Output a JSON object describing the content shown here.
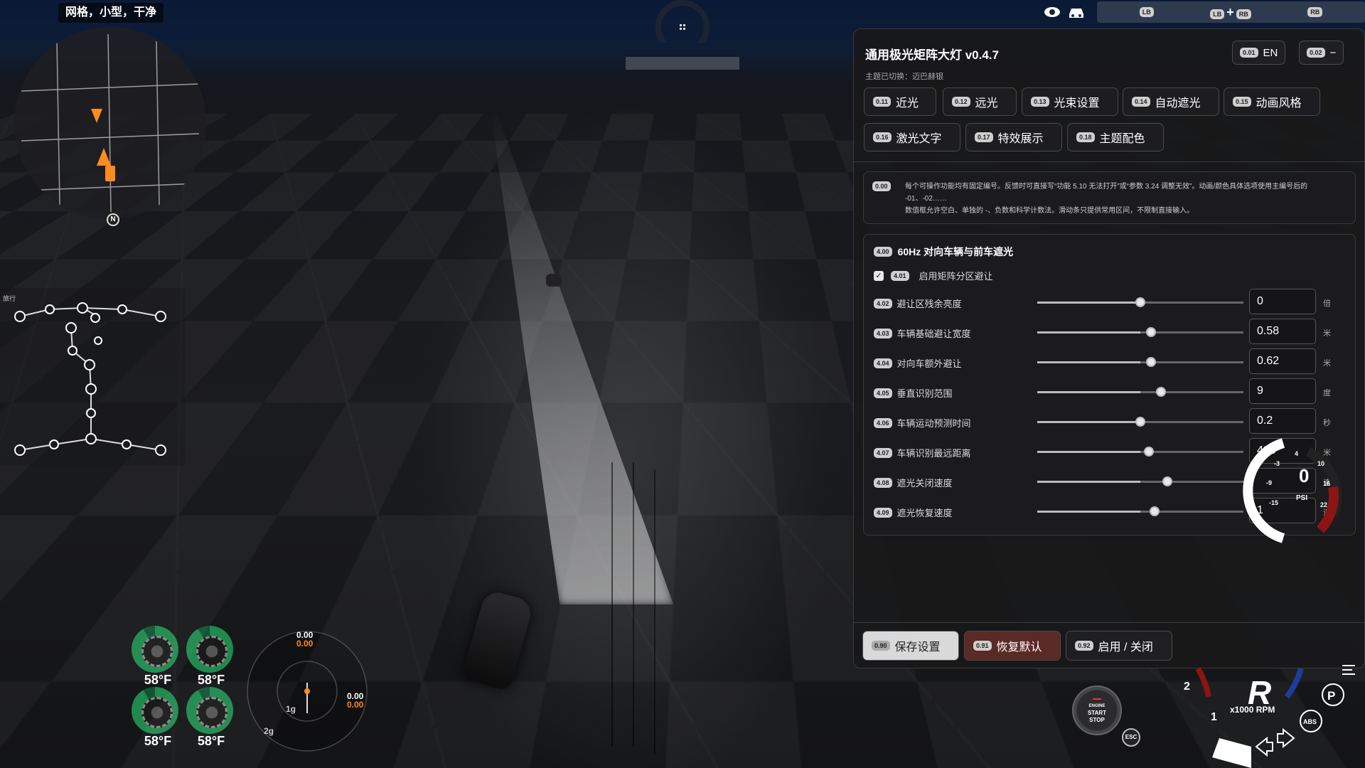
{
  "hud": {
    "map_mode": "网格，小型，干净",
    "north": "N",
    "top_buttons": {
      "btn_lb": "LB",
      "combo_lb": "LB",
      "combo_plus": "+",
      "combo_rb": "RB",
      "btn_rb": "RB"
    },
    "controller_label": "旅行"
  },
  "tires": {
    "fl": "58°F",
    "fr": "58°F",
    "rl": "58°F",
    "rr": "58°F"
  },
  "gmeter": {
    "top_white": "0.00",
    "top_orange": "0.00",
    "right_white": "0.00",
    "right_orange": "0.00",
    "ring1": "1g",
    "ring2": "2g"
  },
  "panel": {
    "title": "通用极光矩阵大灯 v0.4.7",
    "subtitle": "主题已切换：迈巴赫银",
    "lang": {
      "code": "0.01",
      "label": "EN"
    },
    "minimize": {
      "code": "0.02",
      "label": "−"
    },
    "tabs": [
      {
        "code": "0.11",
        "label": "近光"
      },
      {
        "code": "0.12",
        "label": "远光"
      },
      {
        "code": "0.13",
        "label": "光束设置"
      },
      {
        "code": "0.14",
        "label": "自动遮光"
      },
      {
        "code": "0.15",
        "label": "动画风格"
      },
      {
        "code": "0.16",
        "label": "激光文字"
      },
      {
        "code": "0.17",
        "label": "特效展示"
      },
      {
        "code": "0.18",
        "label": "主题配色"
      }
    ],
    "note": {
      "code": "0.00",
      "line1": "每个可操作功能均有固定编号。反馈时可直接写“功能 5.10 无法打开”或“参数 3.24 调整无效”。动画/颜色具体选项使用主编号后的 -01、-02……",
      "line2": "数值框允许空白、单独的 -、负数和科学计数法。滑动条只提供常用区间，不限制直接输入。"
    },
    "section": {
      "code": "4.00",
      "title": "60Hz 对向车辆与前车遮光",
      "checkbox": {
        "code": "4.01",
        "label": "启用矩阵分区避让",
        "checked": true
      },
      "rows": [
        {
          "code": "4.02",
          "label": "避让区残余亮度",
          "value": "0",
          "unit": "倍",
          "fraction": 0.5
        },
        {
          "code": "4.03",
          "label": "车辆基础避让宽度",
          "value": "0.58",
          "unit": "米",
          "fraction": 0.55
        },
        {
          "code": "4.04",
          "label": "对向车额外避让",
          "value": "0.62",
          "unit": "米",
          "fraction": 0.55
        },
        {
          "code": "4.05",
          "label": "垂直识别范围",
          "value": "9",
          "unit": "度",
          "fraction": 0.6
        },
        {
          "code": "4.06",
          "label": "车辆运动预测时间",
          "value": "0.2",
          "unit": "秒",
          "fraction": 0.5
        },
        {
          "code": "4.07",
          "label": "车辆识别最远距离",
          "value": "420",
          "unit": "米",
          "fraction": 0.54
        },
        {
          "code": "4.08",
          "label": "遮光关闭速度",
          "value": "",
          "unit": "速",
          "fraction": 0.63
        },
        {
          "code": "4.09",
          "label": "遮光恢复速度",
          "value": "1",
          "unit": "速",
          "fraction": 0.57
        }
      ]
    },
    "footer": [
      {
        "code": "0.90",
        "label": "保存设置"
      },
      {
        "code": "0.91",
        "label": "恢复默认"
      },
      {
        "code": "0.92",
        "label": "启用 / 关闭"
      }
    ]
  },
  "boost_gauge": {
    "value": "0",
    "unit": "PSI",
    "ticks": [
      "-3",
      "-9",
      "-15",
      "4",
      "10",
      "16",
      "22"
    ]
  },
  "dash": {
    "gear": "R",
    "rpm_label": "x1000 RPM",
    "rpm_tick_2": "2",
    "rpm_tick_1": "1",
    "park": "P",
    "abs": "ABS",
    "engine_line1": "ENGINE",
    "engine_line2": "START",
    "engine_line3": "STOP",
    "esc": "ESC"
  },
  "colors": {
    "accent_orange": "#ff8a1e",
    "tire_green": "#1f8a4c",
    "restore_red": "#5a2a26",
    "save_gray": "#d9d9d9"
  }
}
